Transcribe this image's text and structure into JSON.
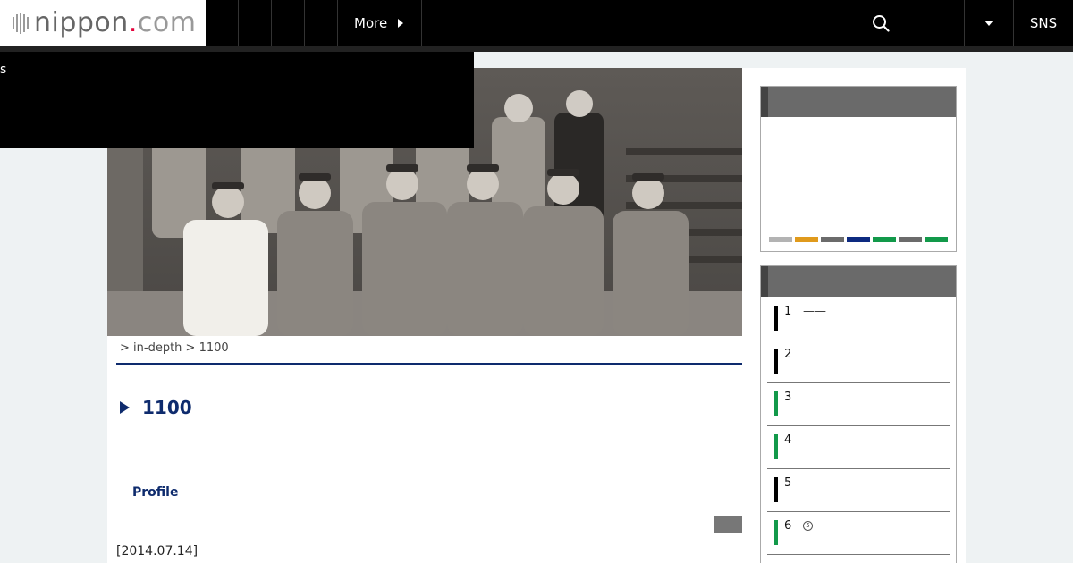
{
  "header": {
    "logo_name": "nippon",
    "logo_dot": ".",
    "logo_tld": "com",
    "more_label": "More",
    "sns_label": "SNS",
    "icons": {
      "search": "search-icon",
      "lang": "caret-down-icon",
      "more": "caret-right-icon"
    }
  },
  "dropdown": {
    "partial_text": "s"
  },
  "breadcrumb": {
    "text": "> in-depth > 1100"
  },
  "article": {
    "title": "1100",
    "profile_label": "Profile",
    "date": "[2014.07.14]"
  },
  "sidebar": {
    "color_bar": [
      "#b3b3b3",
      "#e09a1c",
      "#6b6b6b",
      "#0d2a80",
      "#12994a",
      "#6b6b6b",
      "#12994a"
    ],
    "ranking": [
      {
        "num": "1",
        "title": "——",
        "bar_color": "#000000"
      },
      {
        "num": "2",
        "title": "",
        "bar_color": "#000000"
      },
      {
        "num": "3",
        "title": "",
        "bar_color": "#12994a"
      },
      {
        "num": "4",
        "title": "",
        "bar_color": "#12994a"
      },
      {
        "num": "5",
        "title": "",
        "bar_color": "#000000"
      },
      {
        "num": "6",
        "title": "",
        "badge": "5",
        "bar_color": "#12994a"
      }
    ]
  },
  "colors": {
    "navy": "#0e2b6d",
    "header_bg": "#000000",
    "page_bg": "#eef2f3"
  }
}
